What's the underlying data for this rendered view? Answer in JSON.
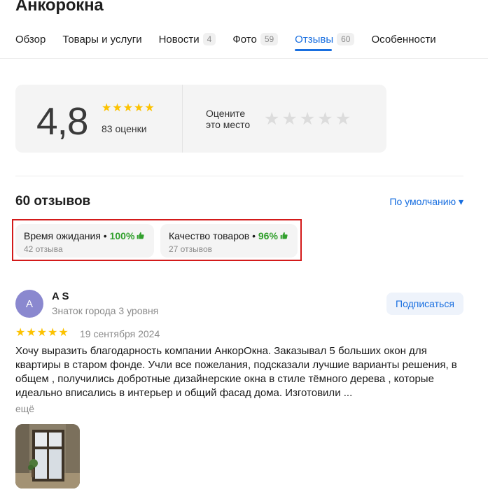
{
  "header": {
    "title": "Анкорокна"
  },
  "tabs": [
    {
      "label": "Обзор",
      "count": null,
      "active": false
    },
    {
      "label": "Товары и услуги",
      "count": null,
      "active": false
    },
    {
      "label": "Новости",
      "count": "4",
      "active": false
    },
    {
      "label": "Фото",
      "count": "59",
      "active": false
    },
    {
      "label": "Отзывы",
      "count": "60",
      "active": true
    },
    {
      "label": "Особенности",
      "count": null,
      "active": false
    }
  ],
  "rating": {
    "value": "4,8",
    "stars": "★★★★★",
    "count_label": "83 оценки",
    "rate_prompt_line1": "Оцените",
    "rate_prompt_line2": "это место",
    "rate_stars": "★★★★★"
  },
  "reviews": {
    "heading": "60 отзывов",
    "sort_label": "По умолчанию ▾"
  },
  "aspects": [
    {
      "title": "Время ожидания",
      "sep": " • ",
      "percent": "100%",
      "thumb": "👍",
      "count": "42 отзыва"
    },
    {
      "title": "Качество товаров",
      "sep": " • ",
      "percent": "96%",
      "thumb": "👍",
      "count": "27 отзывов"
    }
  ],
  "review": {
    "avatar_letter": "A",
    "author": "A S",
    "level": "Знаток города 3 уровня",
    "subscribe_label": "Подписаться",
    "stars": "★★★★★",
    "date": "19 сентября 2024",
    "text": "Хочу выразить благодарность компании АнкорОкна. Заказывал 5 больших окон для квартиры в старом фонде. Учли все пожелания, подсказали лучшие варианты решения, в общем , получились добротные дизайнерские окна в стиле тёмного дерева , которые идеально вписались в интерьер и общий фасад дома. Изготовили ...",
    "more_label": "ещё"
  },
  "colors": {
    "accent": "#196fe0",
    "star": "#fcc200",
    "positive": "#31a02d",
    "highlight": "#d31a1a"
  }
}
